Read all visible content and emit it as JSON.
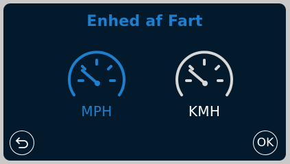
{
  "screen": {
    "title": "Enhed af Fart"
  },
  "options": [
    {
      "label": "MPH",
      "selected": true,
      "icon": "speedometer-icon",
      "color": "#1e7fcf"
    },
    {
      "label": "KMH",
      "selected": false,
      "icon": "speedometer-icon",
      "color": "#ffffff"
    }
  ],
  "buttons": {
    "back_icon": "back-arrow-icon",
    "ok_label": "OK"
  },
  "colors": {
    "background": "#031a2c",
    "accent": "#1e7fcf",
    "text": "#ffffff"
  }
}
